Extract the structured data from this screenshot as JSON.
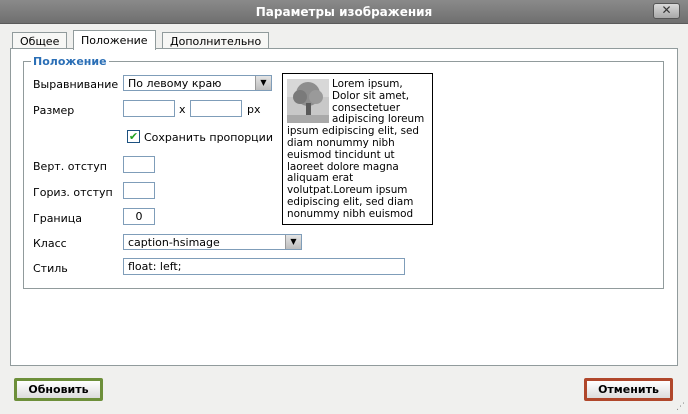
{
  "window": {
    "title": "Параметры изображения",
    "close_symbol": "✕"
  },
  "tabs": [
    {
      "label": "Общее",
      "active": false
    },
    {
      "label": "Положение",
      "active": true
    },
    {
      "label": "Дополнительно",
      "active": false
    }
  ],
  "section": {
    "legend": "Положение"
  },
  "alignment": {
    "label": "Выравнивание",
    "value": "По левому краю"
  },
  "size": {
    "label": "Размер",
    "width": "",
    "height": "",
    "separator": "x",
    "unit": "px"
  },
  "keep_proportions": {
    "label": "Сохранить пропорции",
    "checked": true
  },
  "vspace": {
    "label": "Верт. отступ",
    "value": ""
  },
  "hspace": {
    "label": "Гориз. отступ",
    "value": ""
  },
  "border": {
    "label": "Граница",
    "value": "0"
  },
  "class_field": {
    "label": "Класс",
    "value": "caption-hsimage"
  },
  "style_field": {
    "label": "Стиль",
    "value": "float: left;"
  },
  "preview": {
    "text": "Lorem ipsum, Dolor sit amet, consectetuer adipiscing loreum ipsum edipiscing elit, sed diam nonummy nibh euismod tincidunt ut laoreet dolore magna aliquam erat volutpat.Loreum ipsum edipiscing elit, sed diam nonummy nibh euismod"
  },
  "buttons": {
    "update": "Обновить",
    "cancel": "Отменить"
  }
}
